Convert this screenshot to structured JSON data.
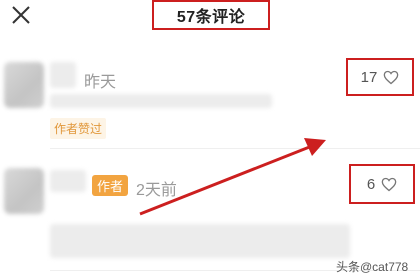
{
  "header": {
    "title": "57条评论",
    "close_icon": "close-icon"
  },
  "comments": [
    {
      "time": "昨天",
      "badge": "作者赞过",
      "likes": "17",
      "like_icon": "heart-outline-icon"
    },
    {
      "author_badge": "作者",
      "time": "2天前",
      "likes": "6",
      "like_icon": "heart-outline-icon"
    }
  ],
  "annotation": {
    "color": "#cc1f1f"
  },
  "watermark": {
    "text": "头条@cat778"
  }
}
